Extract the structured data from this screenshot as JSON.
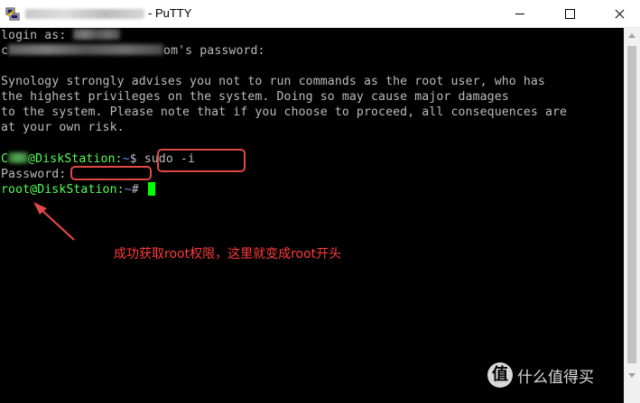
{
  "window": {
    "app_title": "PuTTY",
    "title_prefix": "- PuTTY"
  },
  "icons": {
    "app": "putty-icon",
    "minimize": "minimize-icon",
    "maximize": "maximize-icon",
    "close": "close-icon"
  },
  "terminal": {
    "login_label": "login as:",
    "password_suffix": "om's password:",
    "warning_lines": [
      "Synology strongly advises you not to run commands as the root user, who has",
      "the highest privileges on the system. Doing so may cause major damages",
      "to the system. Please note that if you choose to proceed, all consequences are",
      "at your own risk."
    ],
    "prompt_user_suffix": "@DiskStation:",
    "prompt_path": "~",
    "prompt_symbol": "$",
    "command": "sudo -i",
    "password_prompt": "Password:",
    "root_prompt_user": "root@DiskStation:",
    "root_prompt_path": "~",
    "root_prompt_symbol": "#"
  },
  "annotation": {
    "text": "成功获取root权限，这里就变成root开头",
    "color": "#ff3b3b"
  },
  "watermark": {
    "logo": "值",
    "text": "什么值得买"
  },
  "colors": {
    "terminal_bg": "#000000",
    "terminal_fg": "#bbbbbb",
    "prompt_green": "#54ff54",
    "path_blue": "#5b8cff",
    "cursor": "#00ff00",
    "highlight": "#e04848"
  }
}
